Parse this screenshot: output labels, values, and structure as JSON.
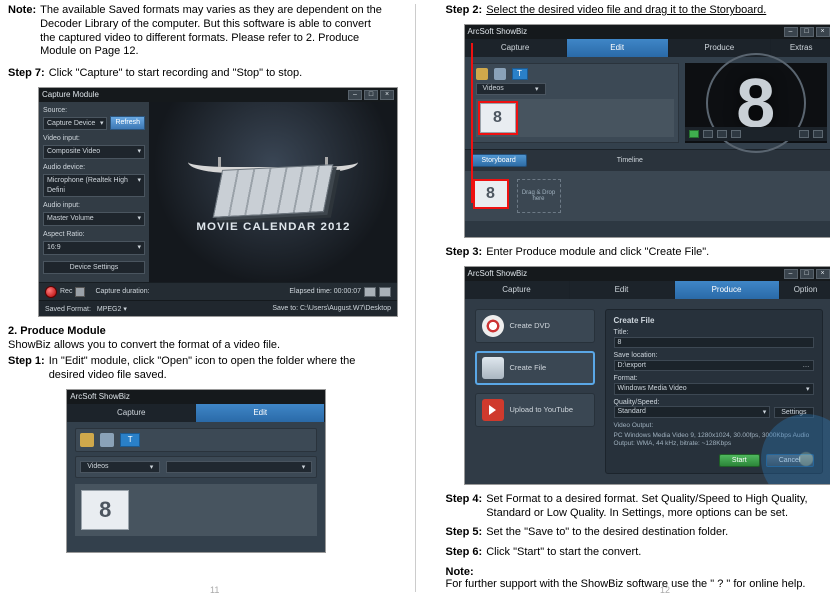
{
  "left": {
    "note": {
      "label": "Note:",
      "body": "The available Saved formats may varies as they are dependent on the Decoder Library of the computer. But this software is able to convert the captured video to different formats. Please refer to 2. Produce Module on Page 12."
    },
    "step7": {
      "label": "Step 7:",
      "body": "Click \"Capture\" to start recording and \"Stop\" to stop."
    },
    "captureMock": {
      "title": "Capture Module",
      "sourceLabel": "Source:",
      "sourceValue": "Capture Device",
      "refresh": "Refresh",
      "videoInLabel": "Video input:",
      "videoInValue": "Composite Video",
      "audioDevLabel": "Audio device:",
      "audioDevValue": "Microphone (Realtek High Defini",
      "audioInLabel": "Audio input:",
      "audioInValue": "Master Volume",
      "aspectLabel": "Aspect Ratio:",
      "aspectValue": "16:9",
      "deviceSettings": "Device Settings",
      "calendarLine1": "MOVIE CALENDAR 2012",
      "recLabel": "Rec",
      "captureDur": "Capture duration:",
      "elapsed": "Elapsed time: 00:00:07",
      "savedFmtLabel": "Saved Format:",
      "savedFmtValue": "MPEG2",
      "saveToLabel": "Save to:",
      "saveToValue": "C:\\Users\\August.W7\\Desktop"
    },
    "section2": {
      "title": "2. Produce Module",
      "intro": "ShowBiz allows you to convert the format of a video file."
    },
    "step1": {
      "label": "Step 1:",
      "body": "In \"Edit\" module, click \"Open\" icon to open the folder where the desired video file saved."
    },
    "editMock": {
      "title": "ArcSoft ShowBiz",
      "tabCapture": "Capture",
      "tabEdit": "Edit",
      "videosLabel": "Videos",
      "tBtn": "T",
      "thumb": "8"
    },
    "pageNum": "11"
  },
  "right": {
    "step2": {
      "label": "Step 2:",
      "body": "Select the desired video file and drag it to the Storyboard."
    },
    "fullMock": {
      "title": "ArcSoft ShowBiz",
      "tabCapture": "Capture",
      "tabEdit": "Edit",
      "tabProduce": "Produce",
      "extras": "Extras",
      "videosLabel": "Videos",
      "big8": "8",
      "storyboard": "Storyboard",
      "timeline": "Timeline",
      "dropHere": "Drag & Drop here",
      "thumb": "8"
    },
    "step3": {
      "label": "Step 3:",
      "body": "Enter Produce module and click \"Create File\"."
    },
    "produceMock": {
      "title": "ArcSoft ShowBiz",
      "tabCapture": "Capture",
      "tabEdit": "Edit",
      "tabProduce": "Produce",
      "option": "Option",
      "optDvd": "Create DVD",
      "optFile": "Create File",
      "optYt": "Upload to YouTube",
      "panelTitle": "Create File",
      "titleLabel": "Title:",
      "titleValue": "8",
      "saveLocLabel": "Save location:",
      "saveLocValue": "D:\\export",
      "formatLabel": "Format:",
      "formatValue": "Windows Media Video",
      "qualityLabel": "Quality/Speed:",
      "qualityValue": "Standard",
      "settings": "Settings",
      "voHeading": "Video Output:",
      "voDetails": "PC Windows Media Video 9, 1280x1024, 30.00fps, 3000Kbps Audio Output: WMA, 44 kHz, bitrate: ~128Kbps",
      "start": "Start",
      "cancel": "Cancel"
    },
    "step4": {
      "label": "Step 4:",
      "body": "Set Format to a desired format. Set Quality/Speed to High Quality, Standard or Low Quality. In Settings, more options can be set."
    },
    "step5": {
      "label": "Step 5:",
      "body": "Set the \"Save to\" to the desired destination folder."
    },
    "step6": {
      "label": "Step 6:",
      "body": "Click \"Start\" to start the convert."
    },
    "note2": {
      "label": "Note:",
      "body": "For further support with the ShowBiz software use the \" ? \" for online help."
    },
    "pageNum": "12"
  }
}
